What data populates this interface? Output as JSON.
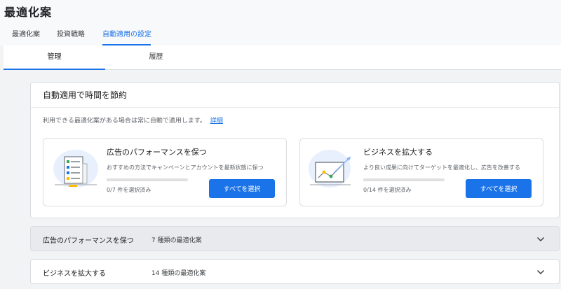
{
  "header": {
    "title": "最適化案",
    "tabs": [
      {
        "label": "最適化案"
      },
      {
        "label": "投資戦略"
      },
      {
        "label": "自動適用の設定"
      }
    ]
  },
  "subtabs": [
    {
      "label": "管理"
    },
    {
      "label": "履歴"
    }
  ],
  "autoapply": {
    "title": "自動適用で時間を節約",
    "description": "利用できる最適化案がある場合は常に自動で適用します。",
    "link": "詳細",
    "cards": [
      {
        "title": "広告のパフォーマンスを保つ",
        "description": "おすすめの方法でキャンペーンとアカウントを最新状態に保つ",
        "progress_label": "0/7 件を選択済み",
        "progress": 0,
        "button": "すべてを選択",
        "icon": "checklist-icon"
      },
      {
        "title": "ビジネスを拡大する",
        "description": "より良い成果に向けてターゲットを最適化し、広告を改善する",
        "progress_label": "0/14 件を選択済み",
        "progress": 0,
        "button": "すべてを選択",
        "icon": "growth-chart-icon"
      }
    ]
  },
  "sections": [
    {
      "title": "広告のパフォーマンスを保つ",
      "count": "7 種類の最適化案"
    },
    {
      "title": "ビジネスを拡大する",
      "count": "14 種類の最適化案"
    }
  ],
  "colors": {
    "accent": "#1a73e8",
    "background": "#f1f3f4",
    "expanded_section": "#e8eaed"
  }
}
